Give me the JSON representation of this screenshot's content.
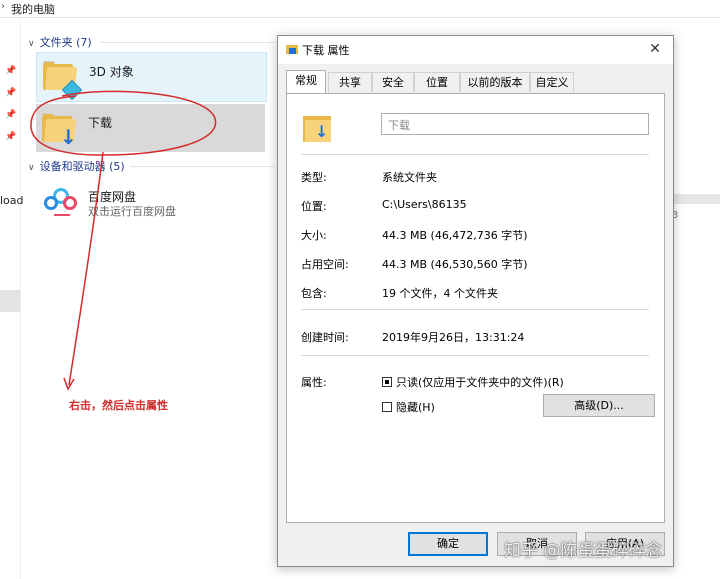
{
  "explorer": {
    "breadcrumb": "我的电脑",
    "nav_partial_text": "load",
    "groups": {
      "folders_label": "文件夹 (7)",
      "devices_label": "设备和驱动器 (5)"
    },
    "items": {
      "objects3d": "3D 对象",
      "downloads": "下载",
      "baidu_name": "百度网盘",
      "baidu_sub": "双击运行百度网盘"
    },
    "right_partial": "3"
  },
  "annotation": {
    "text": "右击，然后点击属性",
    "color": "#d42a2a"
  },
  "dialog": {
    "title": "下载 属性",
    "close_glyph": "✕",
    "tabs": [
      "常规",
      "共享",
      "安全",
      "位置",
      "以前的版本",
      "自定义"
    ],
    "active_tab": "常规",
    "name_value": "下载",
    "fields": {
      "type_label": "类型:",
      "type_value": "系统文件夹",
      "location_label": "位置:",
      "location_value": "C:\\Users\\86135",
      "size_label": "大小:",
      "size_value": "44.3 MB (46,472,736 字节)",
      "disk_label": "占用空间:",
      "disk_value": "44.3 MB (46,530,560 字节)",
      "contains_label": "包含:",
      "contains_value": "19 个文件，4 个文件夹",
      "created_label": "创建时间:",
      "created_value": "2019年9月26日，13:31:24",
      "attr_label": "属性:"
    },
    "attributes": {
      "readonly_label": "只读(仅应用于文件夹中的文件)(R)",
      "readonly_state": "indeterminate",
      "hidden_label": "隐藏(H)",
      "hidden_checked": false,
      "advanced_button": "高级(D)..."
    },
    "buttons": {
      "ok": "确定",
      "cancel": "取消",
      "apply": "应用(A)"
    }
  },
  "watermark": "知乎 @陈蛋蛋碎碎念",
  "colors": {
    "folder": "#e8b94a",
    "accent": "#0078d7",
    "download_arrow": "#1f6fd6"
  }
}
